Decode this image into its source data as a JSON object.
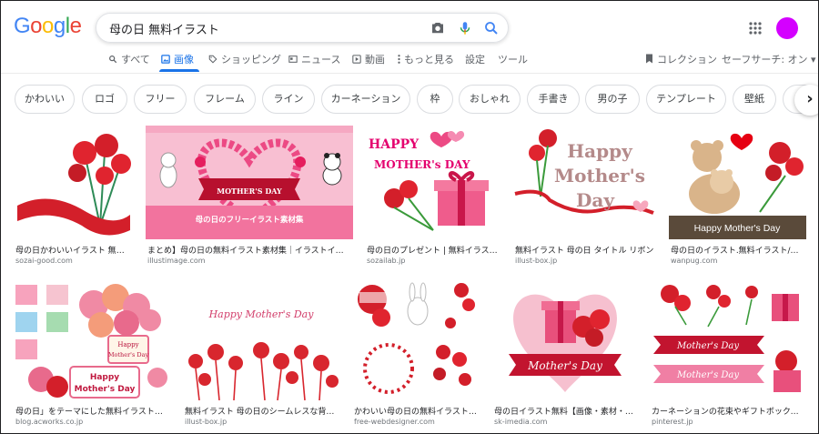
{
  "logo_letters": [
    "G",
    "o",
    "o",
    "g",
    "l",
    "e"
  ],
  "search": {
    "query": "母の日 無料イラスト"
  },
  "icons": {
    "camera": "camera-icon",
    "mic": "mic-icon",
    "search": "search-icon",
    "apps": "apps-grid-icon"
  },
  "colors": {
    "accent": "#1a73e8",
    "avatar": "#d400ff"
  },
  "tabs": [
    {
      "label": "すべて",
      "icon": "search-icon"
    },
    {
      "label": "画像",
      "icon": "image-icon",
      "active": true
    },
    {
      "label": "ショッピング",
      "icon": "tag-icon"
    },
    {
      "label": "ニュース",
      "icon": "news-icon"
    },
    {
      "label": "動画",
      "icon": "play-icon"
    },
    {
      "label": "もっと見る",
      "icon": "more-dots-icon"
    },
    {
      "label": "設定"
    },
    {
      "label": "ツール"
    }
  ],
  "right_links": {
    "collections": "コレクション",
    "safe_search": "セーフサーチ: オン ▾"
  },
  "chips": [
    "かわいい",
    "ロゴ",
    "フリー",
    "フレーム",
    "ライン",
    "カーネーション",
    "枠",
    "おしゃれ",
    "手書き",
    "男の子",
    "テンプレート",
    "壁紙"
  ],
  "results": [
    {
      "caption": "母の日かわいいイラスト 無料…",
      "source": "sozai-good.com"
    },
    {
      "caption": "まとめ】母の日の無料イラスト素材集｜イラストイメ…",
      "source": "illustimage.com",
      "text1": "MOTHER'S DAY",
      "text2": "母の日のフリーイラスト素材集"
    },
    {
      "caption": "母の日のプレゼント | 無料イラス…",
      "source": "sozailab.jp",
      "text1": "HAPPY",
      "text2": "MOTHER's DAY"
    },
    {
      "caption": "無料イラスト 母の日 タイトル リボン",
      "source": "illust-box.jp",
      "text1": "Happy",
      "text2": "Mother's",
      "text3": "Day"
    },
    {
      "caption": "母の日のイラスト.無料イラスト/フ…",
      "source": "wanpug.com",
      "text1": "Happy Mother's Day"
    },
    {
      "caption": "母の日」をテーマにした無料イラスト素…",
      "source": "blog.acworks.co.jp",
      "text1": "Happy",
      "text2": "Mother's Day"
    },
    {
      "caption": "無料イラスト 母の日のシームレスな背景…",
      "source": "illust-box.jp",
      "text1": "Happy Mother's Day"
    },
    {
      "caption": "かわいい母の日の無料イラスト…",
      "source": "free-webdesigner.com"
    },
    {
      "caption": "母の日イラスト無料【画像・素材・…",
      "source": "sk-imedia.com",
      "text1": "Mother's Day"
    },
    {
      "caption": "カーネーションの花束やギフトボックス…",
      "source": "pinterest.jp",
      "text1": "Mother's Day",
      "text2": "Mother's Day"
    }
  ]
}
